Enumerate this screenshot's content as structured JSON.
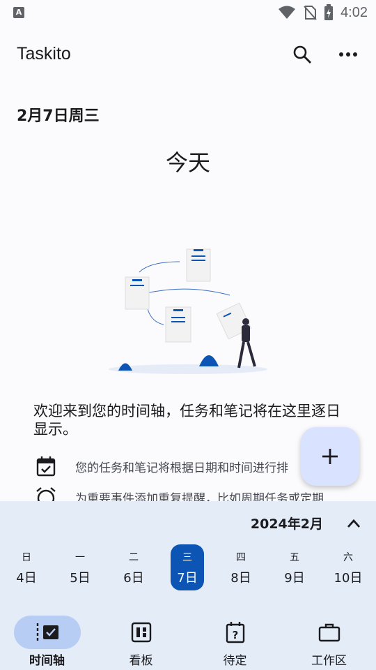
{
  "status": {
    "time": "4:02",
    "left_icon": "A"
  },
  "app": {
    "title": "Taskito"
  },
  "header": {
    "date": "2月7日周三",
    "title": "今天"
  },
  "welcome": {
    "text": "欢迎来到您的时间轴，任务和笔记将在这里逐日显示。"
  },
  "tips": [
    {
      "icon": "calendar-check-icon",
      "text": "您的任务和笔记将根据日期和时间进行排"
    },
    {
      "icon": "alarm-icon",
      "text": "为重要事件添加重复提醒，比如周期任务或定期"
    }
  ],
  "calendar": {
    "month": "2024年2月",
    "days": [
      {
        "weekday": "日",
        "date": "4日",
        "selected": false
      },
      {
        "weekday": "一",
        "date": "5日",
        "selected": false
      },
      {
        "weekday": "二",
        "date": "6日",
        "selected": false
      },
      {
        "weekday": "三",
        "date": "7日",
        "selected": true
      },
      {
        "weekday": "四",
        "date": "8日",
        "selected": false
      },
      {
        "weekday": "五",
        "date": "9日",
        "selected": false
      },
      {
        "weekday": "六",
        "date": "10日",
        "selected": false
      }
    ]
  },
  "nav": [
    {
      "label": "时间轴",
      "icon": "timeline-icon",
      "active": true
    },
    {
      "label": "看板",
      "icon": "board-icon",
      "active": false
    },
    {
      "label": "待定",
      "icon": "pending-icon",
      "active": false
    },
    {
      "label": "工作区",
      "icon": "briefcase-icon",
      "active": false
    }
  ],
  "colors": {
    "accent": "#0d55b5",
    "sheet": "#e3ecf7",
    "fab": "#d9e2ff",
    "nav_pill": "#b8cdf4"
  }
}
